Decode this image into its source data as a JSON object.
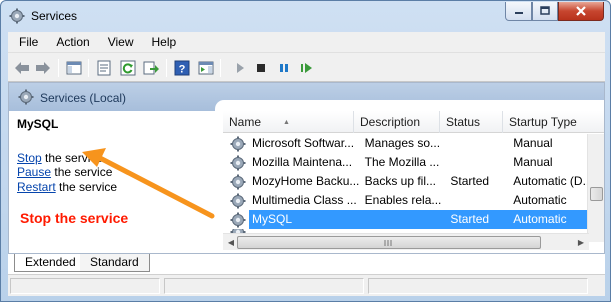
{
  "window": {
    "title": "Services",
    "controls": {
      "minimize": "minimize",
      "maximize": "maximize",
      "close": "close"
    }
  },
  "menu": [
    "File",
    "Action",
    "View",
    "Help"
  ],
  "toolbar": {
    "icons": [
      "back-arrow-icon",
      "forward-arrow-icon",
      "show-hide-console-tree-icon",
      "properties-icon",
      "refresh-icon",
      "export-list-icon",
      "help-icon",
      "action-pane-icon",
      "start-service-icon",
      "stop-service-icon",
      "pause-service-icon",
      "restart-service-icon"
    ]
  },
  "pane_header": {
    "title": "Services (Local)"
  },
  "details": {
    "service_name": "MySQL",
    "actions": [
      {
        "link": "Stop",
        "rest": " the service"
      },
      {
        "link": "Pause",
        "rest": " the service"
      },
      {
        "link": "Restart",
        "rest": " the service"
      }
    ],
    "annotation": "Stop the service"
  },
  "services_list": {
    "columns": [
      "Name",
      "Description",
      "Status",
      "Startup Type"
    ],
    "rows": [
      {
        "name": "Microsoft Softwar...",
        "description": "Manages so...",
        "status": "",
        "startup": "Manual",
        "selected": false
      },
      {
        "name": "Mozilla Maintena...",
        "description": "The Mozilla ...",
        "status": "",
        "startup": "Manual",
        "selected": false
      },
      {
        "name": "MozyHome Backu...",
        "description": "Backs up fil...",
        "status": "Started",
        "startup": "Automatic (D...",
        "selected": false
      },
      {
        "name": "Multimedia Class ...",
        "description": "Enables rela...",
        "status": "",
        "startup": "Automatic",
        "selected": false
      },
      {
        "name": "MySQL",
        "description": "",
        "status": "Started",
        "startup": "Automatic",
        "selected": true
      }
    ]
  },
  "tabs": [
    "Extended",
    "Standard"
  ],
  "colors": {
    "selection": "#3399ff",
    "link": "#0645ad",
    "annotation": "#ff1a00",
    "arrow": "#f7941d"
  }
}
